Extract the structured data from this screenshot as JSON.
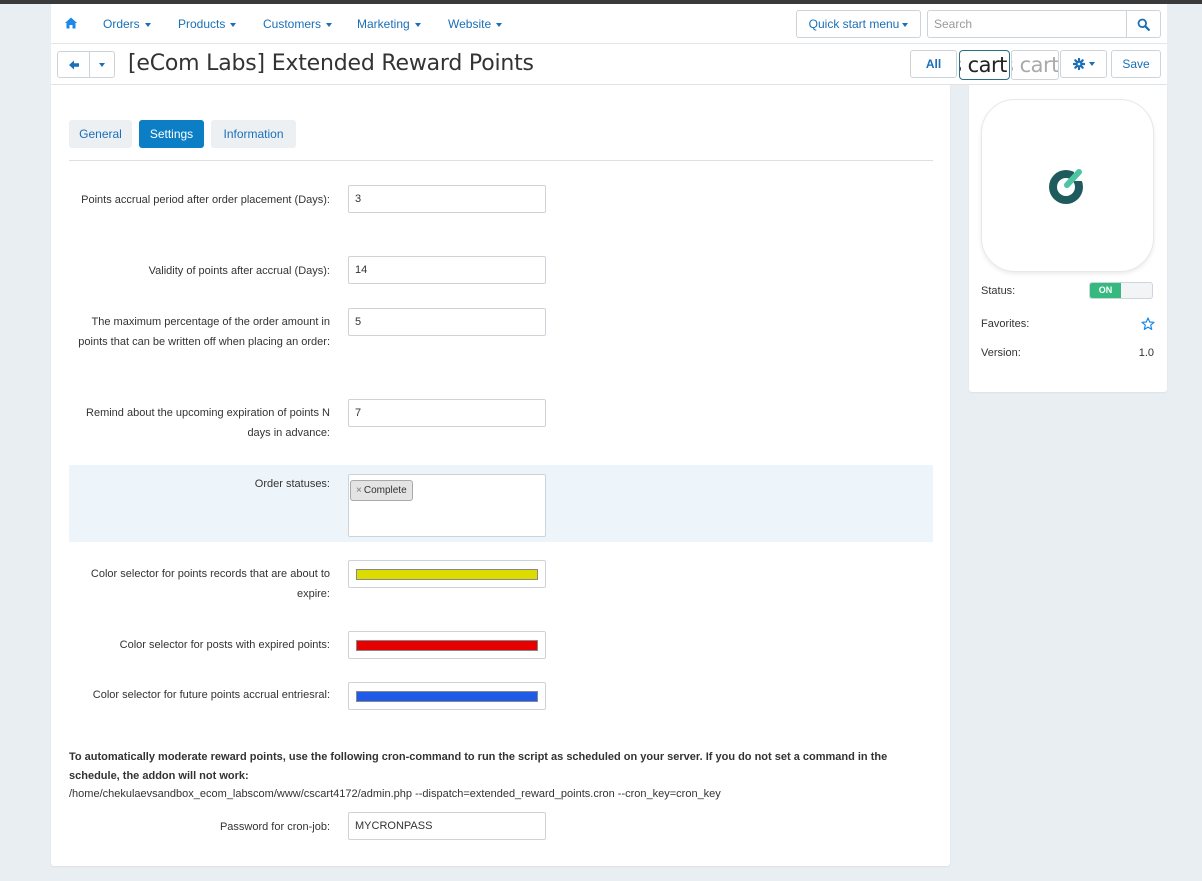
{
  "nav": {
    "home_icon": "home-icon",
    "menus": [
      "Orders",
      "Products",
      "Customers",
      "Marketing",
      "Website"
    ],
    "quick_start": "Quick start menu",
    "search_placeholder": "Search",
    "search_icon": "search-icon"
  },
  "titlebar": {
    "title": "[eCom Labs] Extended Reward Points",
    "back_icon": "arrow-left-icon",
    "all_label": "All",
    "logo_text_1": "s cart",
    "logo_text_2": "s cart",
    "gear_icon": "gear-icon",
    "save_label": "Save"
  },
  "tabs": [
    {
      "label": "General",
      "active": false
    },
    {
      "label": "Settings",
      "active": true
    },
    {
      "label": "Information",
      "active": false
    }
  ],
  "settings": {
    "accrual_period": {
      "label": "Points accrual period after order placement (Days):",
      "value": "3"
    },
    "validity": {
      "label": "Validity of points after accrual (Days):",
      "value": "14"
    },
    "max_percent": {
      "label": "The maximum percentage of the order amount in points that can be written off when placing an order:",
      "value": "5"
    },
    "remind": {
      "label": "Remind about the upcoming expiration of points N days in advance:",
      "value": "7"
    },
    "order_statuses": {
      "label": "Order statuses:",
      "chip_remove": "×",
      "chip": "Complete"
    },
    "color_expire": {
      "label": "Color selector for points records that are about to expire:",
      "color": "#dcdc00"
    },
    "color_expired": {
      "label": "Color selector for posts with expired points:",
      "color": "#e60000"
    },
    "color_future": {
      "label": "Color selector for future points accrual entriesral:",
      "color": "#1f5be6"
    },
    "cron_note": "To automatically moderate reward points, use the following cron-command to run the script as scheduled on your server. If you do not set a command in the schedule, the addon will not work:",
    "cron_path": "/home/chekulaevsandbox_ecom_labscom/www/cscart4172/admin.php --dispatch=extended_reward_points.cron --cron_key=cron_key",
    "cron_password": {
      "label": "Password for cron-job:",
      "value": "MYCRONPASS"
    }
  },
  "sidebar": {
    "addon_icon": "ecom-labs-logo-icon",
    "status_label": "Status:",
    "status_value": "ON",
    "favorites_label": "Favorites:",
    "favorites_icon": "star-icon",
    "version_label": "Version:",
    "version_value": "1.0"
  }
}
